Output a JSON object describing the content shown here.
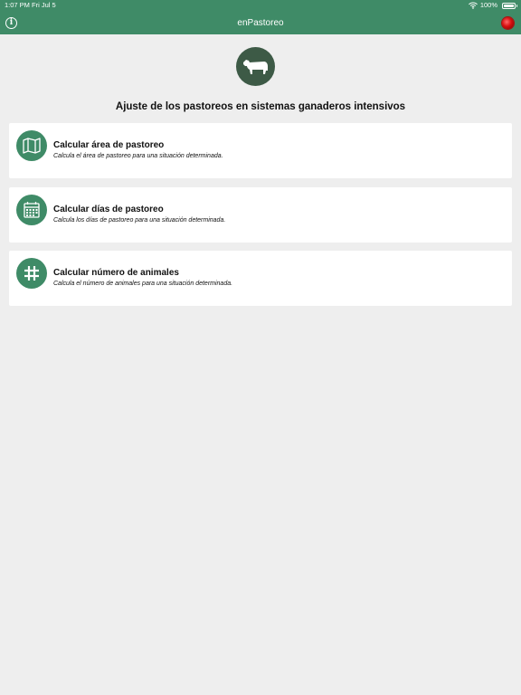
{
  "status_bar": {
    "time": "1:07 PM",
    "date": "Fri Jul 5",
    "battery": "100%",
    "battery_level": 1.0
  },
  "navbar": {
    "title": "enPastoreo",
    "left_icon": "info-icon",
    "right_icon": "record-icon"
  },
  "header": {
    "logo_icon": "cow-icon",
    "title": "Ajuste de los pastoreos en sistemas ganaderos intensivos"
  },
  "options": [
    {
      "icon": "map-icon",
      "title": "Calcular área de pastoreo",
      "description": "Calcula el área de pastoreo para una situación determinada."
    },
    {
      "icon": "calendar-icon",
      "title": "Calcular días de pastoreo",
      "description": "Calcula los días de pastoreo para una situación determinada."
    },
    {
      "icon": "hash-icon",
      "title": "Calcular número de animales",
      "description": "Calcula el número de animales para una situación determinada."
    }
  ],
  "colors": {
    "primary": "#3f8b67",
    "logo_bg": "#3d5a46",
    "background": "#eeeeee",
    "card": "#ffffff"
  }
}
